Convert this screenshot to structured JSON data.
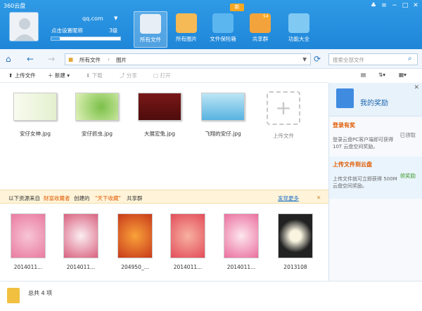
{
  "app_title": "360云盘",
  "window_controls": [
    "shirt-icon",
    "menu-icon",
    "minimize-icon",
    "restore-icon",
    "close-icon"
  ],
  "user": {
    "username": "qq.com",
    "nickname": "点击设置昵称",
    "level": "3级",
    "storage_fraction": 0.12
  },
  "nav": [
    {
      "label": "所有文件",
      "icon": "cloud-files-icon",
      "color": "#e7eef5",
      "active": true
    },
    {
      "label": "所有图片",
      "icon": "images-icon",
      "color": "#f5b955"
    },
    {
      "label": "文件保险箱",
      "icon": "safe-icon",
      "color": "#5bb6f0"
    },
    {
      "label": "共享群",
      "icon": "group-icon",
      "color": "#f3a33c",
      "badge": "54"
    },
    {
      "label": "功能大全",
      "icon": "tools-icon",
      "color": "#7fc9f3"
    }
  ],
  "new_badge": "新",
  "path": {
    "root": "所有文件",
    "current": "图片"
  },
  "search_placeholder": "搜索全部文件",
  "toolbar": {
    "upload": "上传文件",
    "new": "新建",
    "download": "下载",
    "share": "分享",
    "open": "打开"
  },
  "files": [
    {
      "name": "安仔女神.jpg",
      "color": "#f1f4e8"
    },
    {
      "name": "安仔抓虫.jpg",
      "color": "#c5e59a"
    },
    {
      "name": "大展宏兔.jpg",
      "color": "#6b1414"
    },
    {
      "name": "飞翔的安仔.jpg",
      "color": "#7ec8e8"
    }
  ],
  "upload_tile": "上传文件",
  "shared_bar": {
    "prefix": "以下资源来自",
    "source": "财富收藏者",
    "created": "创建的",
    "group": "\"天下收藏\"",
    "suffix": "共享群",
    "more": "发现更多"
  },
  "shared_items": [
    {
      "name": "2014011...",
      "color": "#f4a6c0"
    },
    {
      "name": "2014011...",
      "color": "#e890a8"
    },
    {
      "name": "204950_...",
      "color": "#e65a2a"
    },
    {
      "name": "2014011...",
      "color": "#ee6a70"
    },
    {
      "name": "2014011...",
      "color": "#f08cb4"
    },
    {
      "name": "2013108",
      "color": "#2a2a2a"
    }
  ],
  "status": {
    "count_text": "总共 4 项"
  },
  "sidebar": {
    "title": "我的奖励",
    "cards": [
      {
        "title": "登录有奖",
        "desc": "登录云盘PC客户端即可获得 10T 云盘空间奖励。",
        "status": "已领取"
      },
      {
        "title": "上传文件到云盘",
        "desc": "上传文件就可立即获得 500M 云盘空间奖励。",
        "status": "领奖励"
      }
    ]
  }
}
